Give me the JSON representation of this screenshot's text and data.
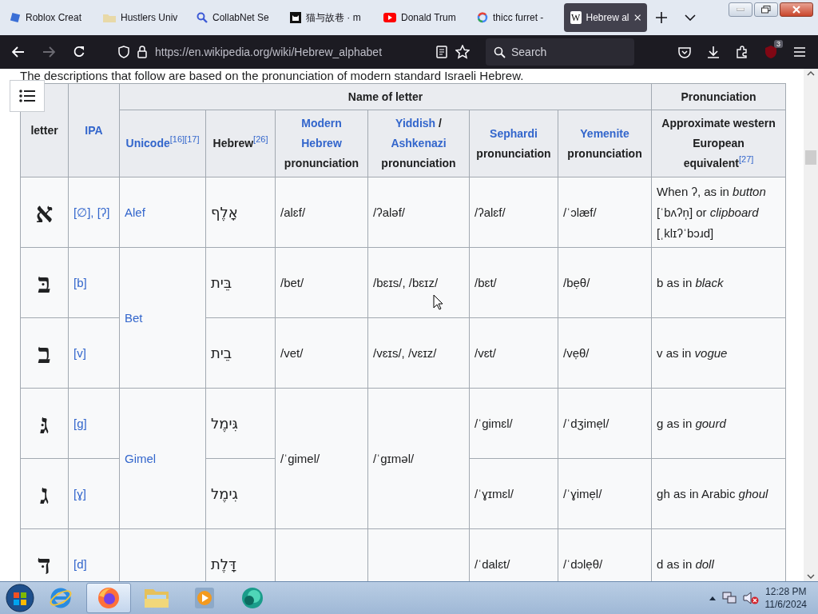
{
  "browser": {
    "tabs": [
      {
        "title": "Roblox Creat",
        "kind": "square",
        "selected": false
      },
      {
        "title": "Hustlers Univ",
        "kind": "folder",
        "selected": false
      },
      {
        "title": "CollabNet Se",
        "kind": "search",
        "selected": false
      },
      {
        "title": "猫与故巷 · m",
        "kind": "cat",
        "selected": false
      },
      {
        "title": "Donald Trum",
        "kind": "play",
        "selected": false
      },
      {
        "title": "thicc furret -",
        "kind": "ring",
        "selected": false
      },
      {
        "title": "Hebrew al",
        "kind": "glyph",
        "glyph": "W",
        "selected": true
      }
    ],
    "address_bar": {
      "url": "https://en.wikipedia.org/wiki/Hebrew_alphabet"
    },
    "search_field": {
      "placeholder": "Search"
    },
    "extension_badge": "3"
  },
  "page": {
    "intro": "The descriptions that follow are based on the pronunciation of modern standard Israeli Hebrew.",
    "table": {
      "header_rows": [
        [
          {
            "text": "letter",
            "rowspan": 2
          },
          {
            "parts": [
              {
                "text": "IPA",
                "kind": "link"
              }
            ],
            "rowspan": 2
          },
          {
            "text": "Name of letter",
            "colspan": 6
          },
          {
            "text": "Pronunciation"
          }
        ],
        [
          {
            "parts": [
              {
                "text": "Unicode",
                "kind": "link"
              },
              {
                "text": "[16]",
                "kind": "ref"
              },
              {
                "text": "[17]",
                "kind": "ref"
              }
            ]
          },
          {
            "parts": [
              {
                "text": "Hebrew",
                "kind": "plain"
              },
              {
                "text": "[26]",
                "kind": "ref"
              }
            ]
          },
          {
            "parts": [
              {
                "text": "Modern Hebrew",
                "kind": "link"
              },
              {
                "text": "pronunciation",
                "kind": "plain"
              }
            ]
          },
          {
            "parts": [
              {
                "text": "Yiddish",
                "kind": "link"
              },
              {
                "text": "/",
                "kind": "plain"
              },
              {
                "text": "Ashkenazi",
                "kind": "link"
              },
              {
                "text": "pronunciation",
                "kind": "plain"
              }
            ]
          },
          {
            "parts": [
              {
                "text": "Sephardi",
                "kind": "link"
              },
              {
                "text": "pronunciation",
                "kind": "plain"
              }
            ]
          },
          {
            "parts": [
              {
                "text": "Yemenite",
                "kind": "link"
              },
              {
                "text": "pronunciation",
                "kind": "plain"
              }
            ]
          },
          {
            "parts": [
              {
                "text": "Approximate western European equivalent",
                "kind": "plain"
              },
              {
                "text": "[27]",
                "kind": "ref"
              }
            ]
          }
        ]
      ],
      "rows": [
        [
          {
            "text": "א"
          },
          {
            "parts": [
              {
                "text": "[∅], [ʔ]",
                "kind": "link"
              }
            ]
          },
          {
            "parts": [
              {
                "text": "Alef",
                "kind": "link"
              }
            ]
          },
          {
            "text": "אָלֶף"
          },
          {
            "text": "/alɛf/"
          },
          {
            "text": "/ʔaləf/"
          },
          {
            "text": "/ʔalɛf/"
          },
          {
            "text": "/ˈɔlæf/"
          },
          {
            "text": "When ʔ, as in *button* [ˈbʌʔn̩] or *clipboard* [ˌklɪʔˈbɔɹd]"
          }
        ],
        [
          {
            "text": "בּ"
          },
          {
            "parts": [
              {
                "text": "[b]",
                "kind": "link"
              }
            ]
          },
          {
            "parts": [
              {
                "text": "Bet",
                "kind": "link"
              }
            ],
            "rowspan": 2
          },
          {
            "text": "בֵּית"
          },
          {
            "text": "/bet/"
          },
          {
            "text": "/bɛɪs/, /bɛɪz/"
          },
          {
            "text": "/bɛt/"
          },
          {
            "text": "/bẹθ/"
          },
          {
            "text": "b as in *black*"
          }
        ],
        [
          {
            "text": "ב"
          },
          {
            "parts": [
              {
                "text": "[v]",
                "kind": "link"
              }
            ]
          },
          {
            "text": "בֵית"
          },
          {
            "text": "/vet/"
          },
          {
            "text": "/vɛɪs/, /vɛɪz/"
          },
          {
            "text": "/vɛt/"
          },
          {
            "text": "/vẹθ/"
          },
          {
            "text": "v as in *vogue*"
          }
        ],
        [
          {
            "text": "גּ"
          },
          {
            "parts": [
              {
                "text": "[g]",
                "kind": "link"
              }
            ]
          },
          {
            "parts": [
              {
                "text": "Gimel",
                "kind": "link"
              }
            ],
            "rowspan": 2
          },
          {
            "text": "גִּימֶל"
          },
          {
            "text": "/ˈgimel/",
            "rowspan": 2
          },
          {
            "text": "/ˈɡɪməl/",
            "rowspan": 2
          },
          {
            "text": "/ˈgimɛl/"
          },
          {
            "text": "/ˈdʒimẹl/"
          },
          {
            "text": "g as in *gourd*"
          }
        ],
        [
          {
            "text": "ג"
          },
          {
            "parts": [
              {
                "text": "[ɣ]",
                "kind": "link"
              }
            ]
          },
          {
            "text": "גִימֶל"
          },
          {
            "text": "/ˈɣɪmɛl/"
          },
          {
            "text": "/ˈɣimẹl/"
          },
          {
            "text": "gh as in Arabic *ghoul*"
          }
        ],
        [
          {
            "text": "דּ"
          },
          {
            "parts": [
              {
                "text": "[d]",
                "kind": "link"
              }
            ]
          },
          {},
          {
            "text": "דָּלֶת"
          },
          {},
          {},
          {
            "text": "/ˈdalɛt/"
          },
          {
            "text": "/ˈdɔlẹθ/"
          },
          {
            "text": "d as in *doll*"
          }
        ]
      ]
    }
  },
  "taskbar": {
    "apps": [
      {
        "kind": "ie",
        "selected": false
      },
      {
        "kind": "firefox",
        "selected": true
      },
      {
        "kind": "folder",
        "selected": false
      },
      {
        "kind": "media",
        "selected": false
      },
      {
        "kind": "bubble",
        "selected": false
      }
    ],
    "clock": {
      "time": "12:28 PM",
      "date": "11/6/2024"
    }
  }
}
